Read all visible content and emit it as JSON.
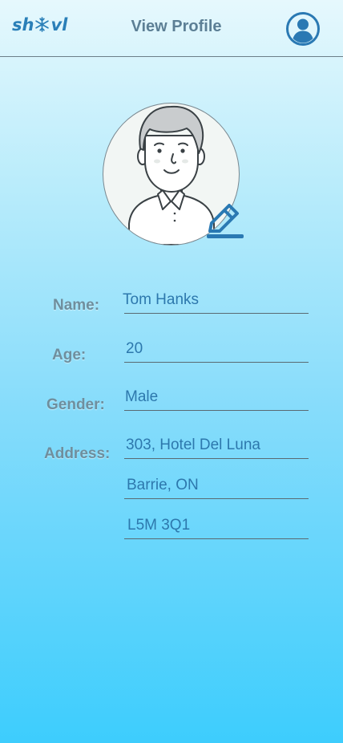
{
  "header": {
    "logo_text_before": "sh",
    "logo_text_after": "vl",
    "logo_icon": "snowflake-icon",
    "title": "View Profile",
    "profile_icon": "user-circle-icon"
  },
  "avatar": {
    "icon": "man-avatar-illustration",
    "edit_icon": "pencil-edit-icon"
  },
  "form": {
    "name_label": "Name:",
    "name_value": "Tom Hanks",
    "age_label": "Age:",
    "age_value": "20",
    "gender_label": "Gender:",
    "gender_value": "Male",
    "address_label": "Address:",
    "address_line1": "303, Hotel Del Luna",
    "address_line2": "Barrie, ON",
    "address_line3": "L5M 3Q1"
  },
  "colors": {
    "accent": "#2d78ad",
    "label": "#6f8e9d",
    "header_title": "#5c7f95"
  }
}
